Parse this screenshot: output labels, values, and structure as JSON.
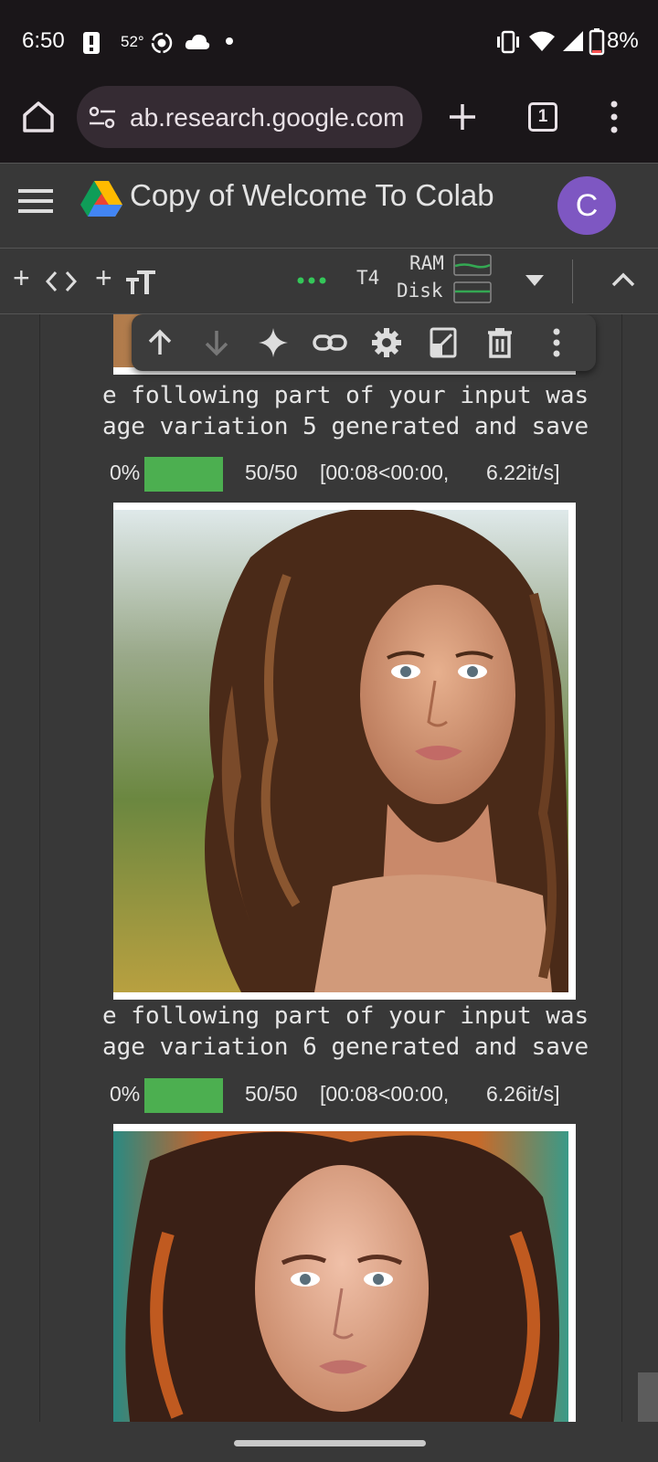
{
  "status_bar": {
    "time": "6:50",
    "temperature": "52°",
    "battery": "8%",
    "icons": [
      "alert-icon",
      "assistant-icon",
      "cloud-icon",
      "dot-icon",
      "vibrate-icon",
      "wifi-icon",
      "signal-icon",
      "battery-icon"
    ]
  },
  "browser": {
    "url": "ab.research.google.com",
    "tab_count": "1",
    "icons": [
      "home-icon",
      "site-settings-icon",
      "new-tab-icon",
      "tabs-icon",
      "more-vert-icon"
    ]
  },
  "colab": {
    "title": "Copy of Welcome To Colab",
    "avatar_letter": "C",
    "runtime": "T4",
    "ram_label": "RAM",
    "disk_label": "Disk",
    "toolbar_labels": {
      "add_code": "+",
      "add_text": "+"
    }
  },
  "cell_toolbar": {
    "icons": [
      "arrow-up-icon",
      "arrow-down-icon",
      "sparkle-icon",
      "link-icon",
      "gear-icon",
      "mirror-icon",
      "trash-icon",
      "more-vert-icon"
    ]
  },
  "output": {
    "blocks": [
      {
        "line1": "e following part of your input was",
        "line2": "age variation 5 generated and save",
        "percent": "0%",
        "count": "50/50",
        "timing": "[00:08<00:00,",
        "rate": "6.22it/s]",
        "progress": 1.0
      },
      {
        "line1": "e following part of your input was",
        "line2": "age variation 6 generated and save",
        "percent": "0%",
        "count": "50/50",
        "timing": "[00:08<00:00,",
        "rate": "6.26it/s]",
        "progress": 1.0
      }
    ]
  },
  "colors": {
    "progress_fill": "#4caf50",
    "avatar_bg": "#7e57c2",
    "runtime_dots": "#34c759",
    "url_pill_bg": "#352b33"
  }
}
